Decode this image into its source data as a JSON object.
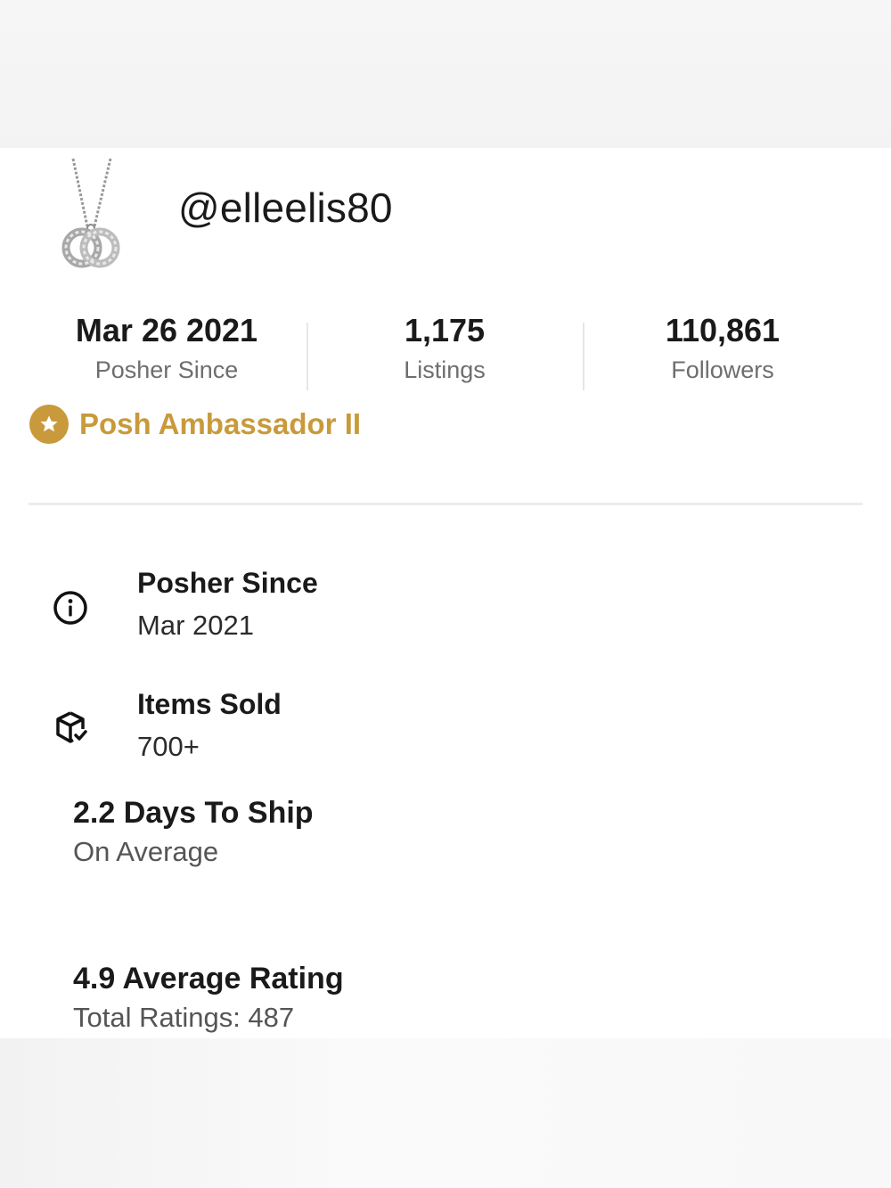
{
  "profile": {
    "username": "@elleelis80",
    "avatar_icon": "necklace-pendant-avatar"
  },
  "stats": [
    {
      "value": "Mar 26 2021",
      "label": "Posher Since"
    },
    {
      "value": "1,175",
      "label": "Listings"
    },
    {
      "value": "110,861",
      "label": "Followers"
    }
  ],
  "ambassador": {
    "label": "Posh Ambassador II",
    "icon": "star-badge-icon",
    "color": "#c99a3b"
  },
  "details": {
    "posher_since": {
      "title": "Posher Since",
      "value": "Mar 2021",
      "icon": "info-icon"
    },
    "items_sold": {
      "title": "Items Sold",
      "value": "700+",
      "icon": "package-check-icon"
    }
  },
  "metrics": {
    "shipping": {
      "title": "2.2 Days To Ship",
      "subtitle": "On Average"
    },
    "rating": {
      "title": "4.9 Average Rating",
      "subtitle": "Total Ratings: 487"
    }
  }
}
